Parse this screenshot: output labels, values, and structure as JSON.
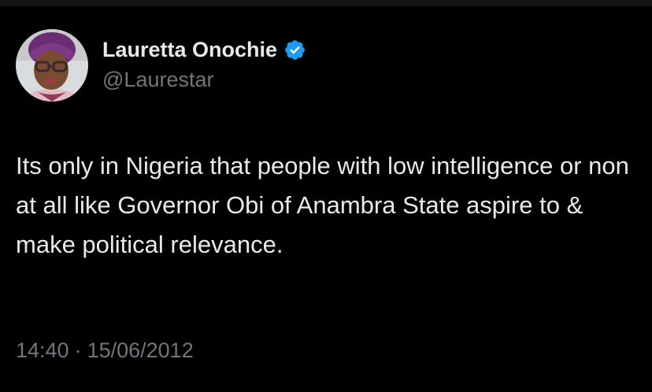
{
  "tweet": {
    "author": {
      "display_name": "Lauretta Onochie",
      "handle": "@Laurestar",
      "verified": true,
      "verified_icon": "verified-badge-icon",
      "avatar": "profile-photo"
    },
    "text": "Its only in Nigeria that people with low intelligence or non at all like Governor Obi of Anambra State aspire to & make political relevance.",
    "time": "14:40",
    "separator": "·",
    "date": "15/06/2012"
  },
  "colors": {
    "background": "#000000",
    "text_primary": "#e7e9ea",
    "text_secondary": "#71767b",
    "verified_blue": "#1d9bf0"
  }
}
